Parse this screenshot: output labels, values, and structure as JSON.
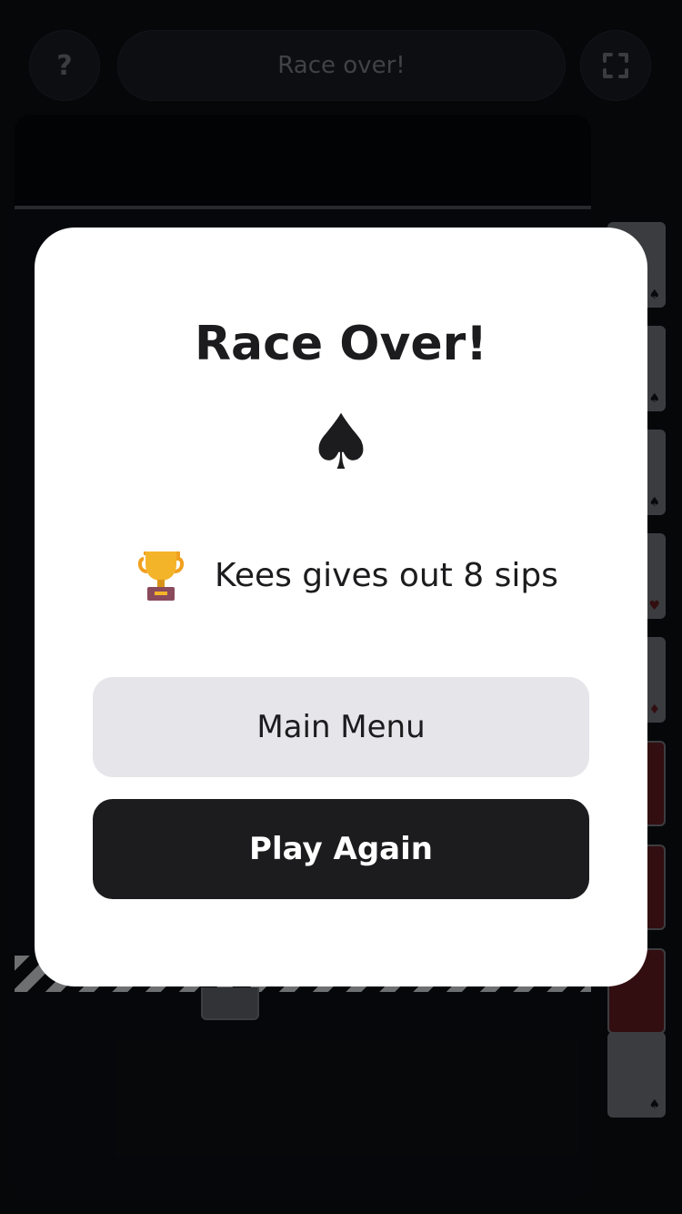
{
  "header": {
    "help_label": "?",
    "status_text": "Race over!"
  },
  "modal": {
    "title": "Race Over!",
    "suit_symbol": "♠",
    "result_text": "Kees gives out 8 sips",
    "main_menu_label": "Main Menu",
    "play_again_label": "Play Again"
  },
  "icons": {
    "help": "question-mark-icon",
    "fullscreen": "fullscreen-icon",
    "suit": "spade-icon",
    "result": "trophy-icon"
  },
  "colors": {
    "background": "#0b0d12",
    "modal": "#ffffff",
    "primary_button": "#1c1c1e",
    "secondary_button": "#e5e5ea"
  }
}
